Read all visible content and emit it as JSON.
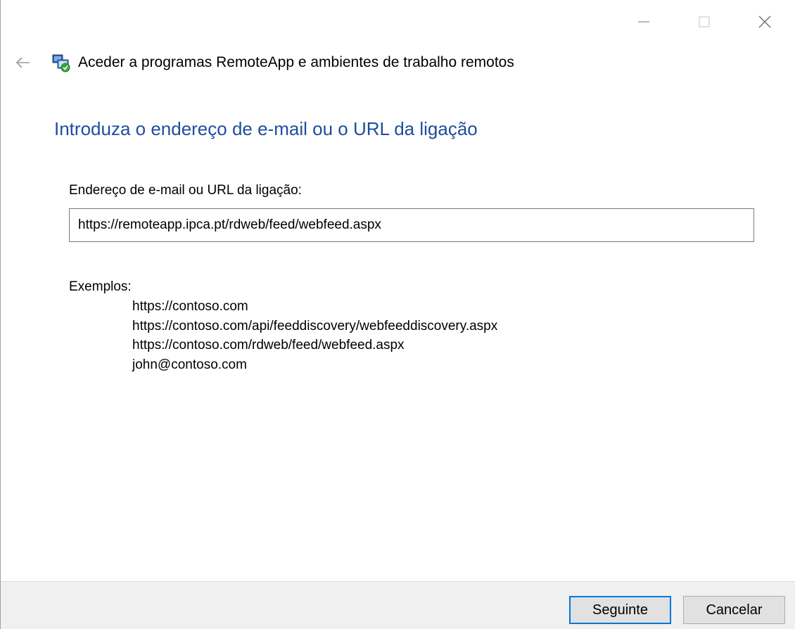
{
  "window": {
    "title": "Aceder a programas RemoteApp e ambientes de trabalho remotos"
  },
  "page": {
    "heading": "Introduza o endereço de e-mail ou o URL da ligação",
    "field_label": "Endereço de e-mail ou URL da ligação:",
    "field_value": "https://remoteapp.ipca.pt/rdweb/feed/webfeed.aspx",
    "examples_label": "Exemplos:",
    "examples": [
      "https://contoso.com",
      "https://contoso.com/api/feeddiscovery/webfeeddiscovery.aspx",
      "https://contoso.com/rdweb/feed/webfeed.aspx",
      "john@contoso.com"
    ]
  },
  "footer": {
    "next_label": "Seguinte",
    "cancel_label": "Cancelar"
  },
  "icons": {
    "back": "back-arrow-icon",
    "app": "remoteapp-icon",
    "minimize": "minimize-icon",
    "maximize": "maximize-icon",
    "close": "close-icon"
  },
  "colors": {
    "heading": "#1e4e9c",
    "default_button_border": "#0078d7",
    "footer_bg": "#f0f0f0"
  }
}
